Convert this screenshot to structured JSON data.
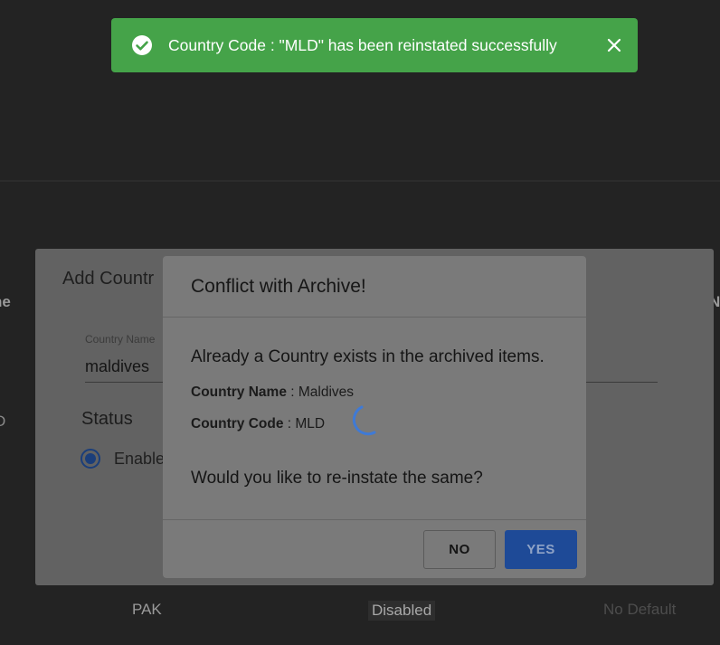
{
  "toast": {
    "message": "Country Code : \"MLD\" has been reinstated successfully",
    "icon": "check-circle-icon",
    "close_icon": "close-icon",
    "color": "#45a349"
  },
  "background_page": {
    "column_left_fragment": "ne",
    "column_right_fragment": "N",
    "cell_left_fragment": "D",
    "row": {
      "code": "PAK",
      "status": "Disabled",
      "default": "No Default"
    }
  },
  "add_dialog": {
    "title": "Add Countr",
    "country_name_label": "Country Name",
    "country_name_value": "maldives",
    "status_heading": "Status",
    "status_option": "Enable"
  },
  "conflict_dialog": {
    "title": "Conflict with Archive!",
    "message": "Already a Country exists in the archived items.",
    "country_name_label": "Country Name",
    "country_name_value": "Maldives",
    "country_code_label": "Country Code",
    "country_code_value": "MLD",
    "question": "Would you like to re-instate the same?",
    "no_label": "NO",
    "yes_label": "YES",
    "accent": "#1e4a97",
    "spinner_color": "#3f7ad6"
  }
}
